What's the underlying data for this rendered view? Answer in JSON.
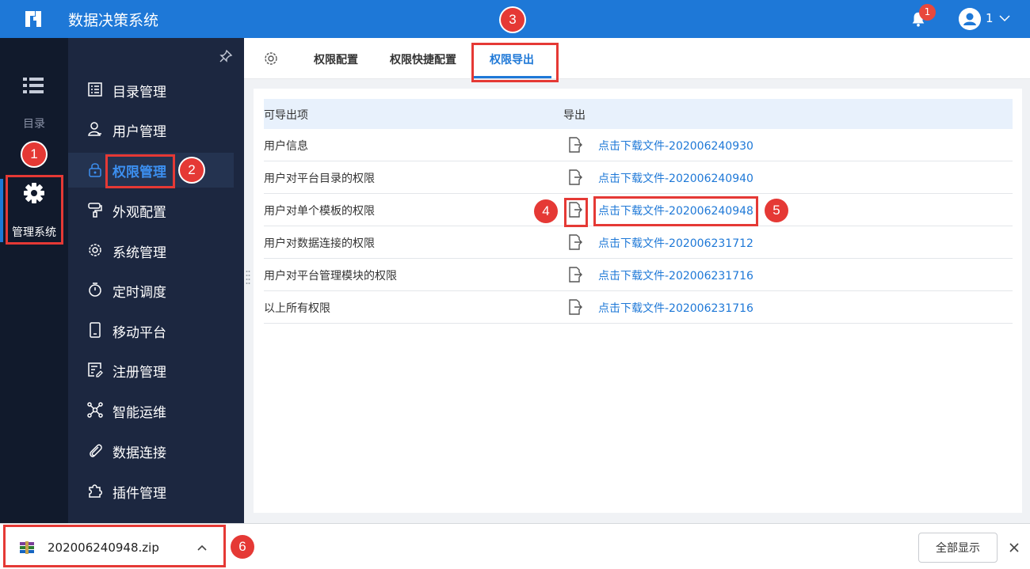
{
  "app": {
    "title": "数据决策系统"
  },
  "header": {
    "notification_count": "1",
    "user_name": "1"
  },
  "rail": {
    "directory_label": "目录",
    "admin_label": "管理系统"
  },
  "submenu": {
    "items": [
      {
        "label": "目录管理",
        "icon": "list-icon"
      },
      {
        "label": "用户管理",
        "icon": "user-icon"
      },
      {
        "label": "权限管理",
        "icon": "lock-icon",
        "active": true
      },
      {
        "label": "外观配置",
        "icon": "paint-roller-icon"
      },
      {
        "label": "系统管理",
        "icon": "gear-icon"
      },
      {
        "label": "定时调度",
        "icon": "stopwatch-icon"
      },
      {
        "label": "移动平台",
        "icon": "mobile-icon"
      },
      {
        "label": "注册管理",
        "icon": "register-icon"
      },
      {
        "label": "智能运维",
        "icon": "network-icon"
      },
      {
        "label": "数据连接",
        "icon": "paperclip-icon"
      },
      {
        "label": "插件管理",
        "icon": "puzzle-icon"
      }
    ]
  },
  "tabs": [
    {
      "label": "权限配置"
    },
    {
      "label": "权限快捷配置"
    },
    {
      "label": "权限导出",
      "active": true
    }
  ],
  "table": {
    "headers": {
      "item": "可导出项",
      "export": "导出"
    },
    "rows": [
      {
        "item": "用户信息",
        "link": "点击下载文件-202006240930"
      },
      {
        "item": "用户对平台目录的权限",
        "link": "点击下载文件-202006240940"
      },
      {
        "item": "用户对单个模板的权限",
        "link": "点击下载文件-202006240948"
      },
      {
        "item": "用户对数据连接的权限",
        "link": "点击下载文件-202006231712"
      },
      {
        "item": "用户对平台管理模块的权限",
        "link": "点击下载文件-202006231716"
      },
      {
        "item": "以上所有权限",
        "link": "点击下载文件-202006231716"
      }
    ]
  },
  "download_bar": {
    "file_name": "202006240948.zip",
    "show_all_label": "全部显示"
  },
  "annotations": [
    "1",
    "2",
    "3",
    "4",
    "5",
    "6"
  ],
  "colors": {
    "brand_blue": "#1e78d7",
    "rail_bg": "#111a2c",
    "submenu_bg": "#1c2740",
    "annotation_red": "#e53935"
  }
}
